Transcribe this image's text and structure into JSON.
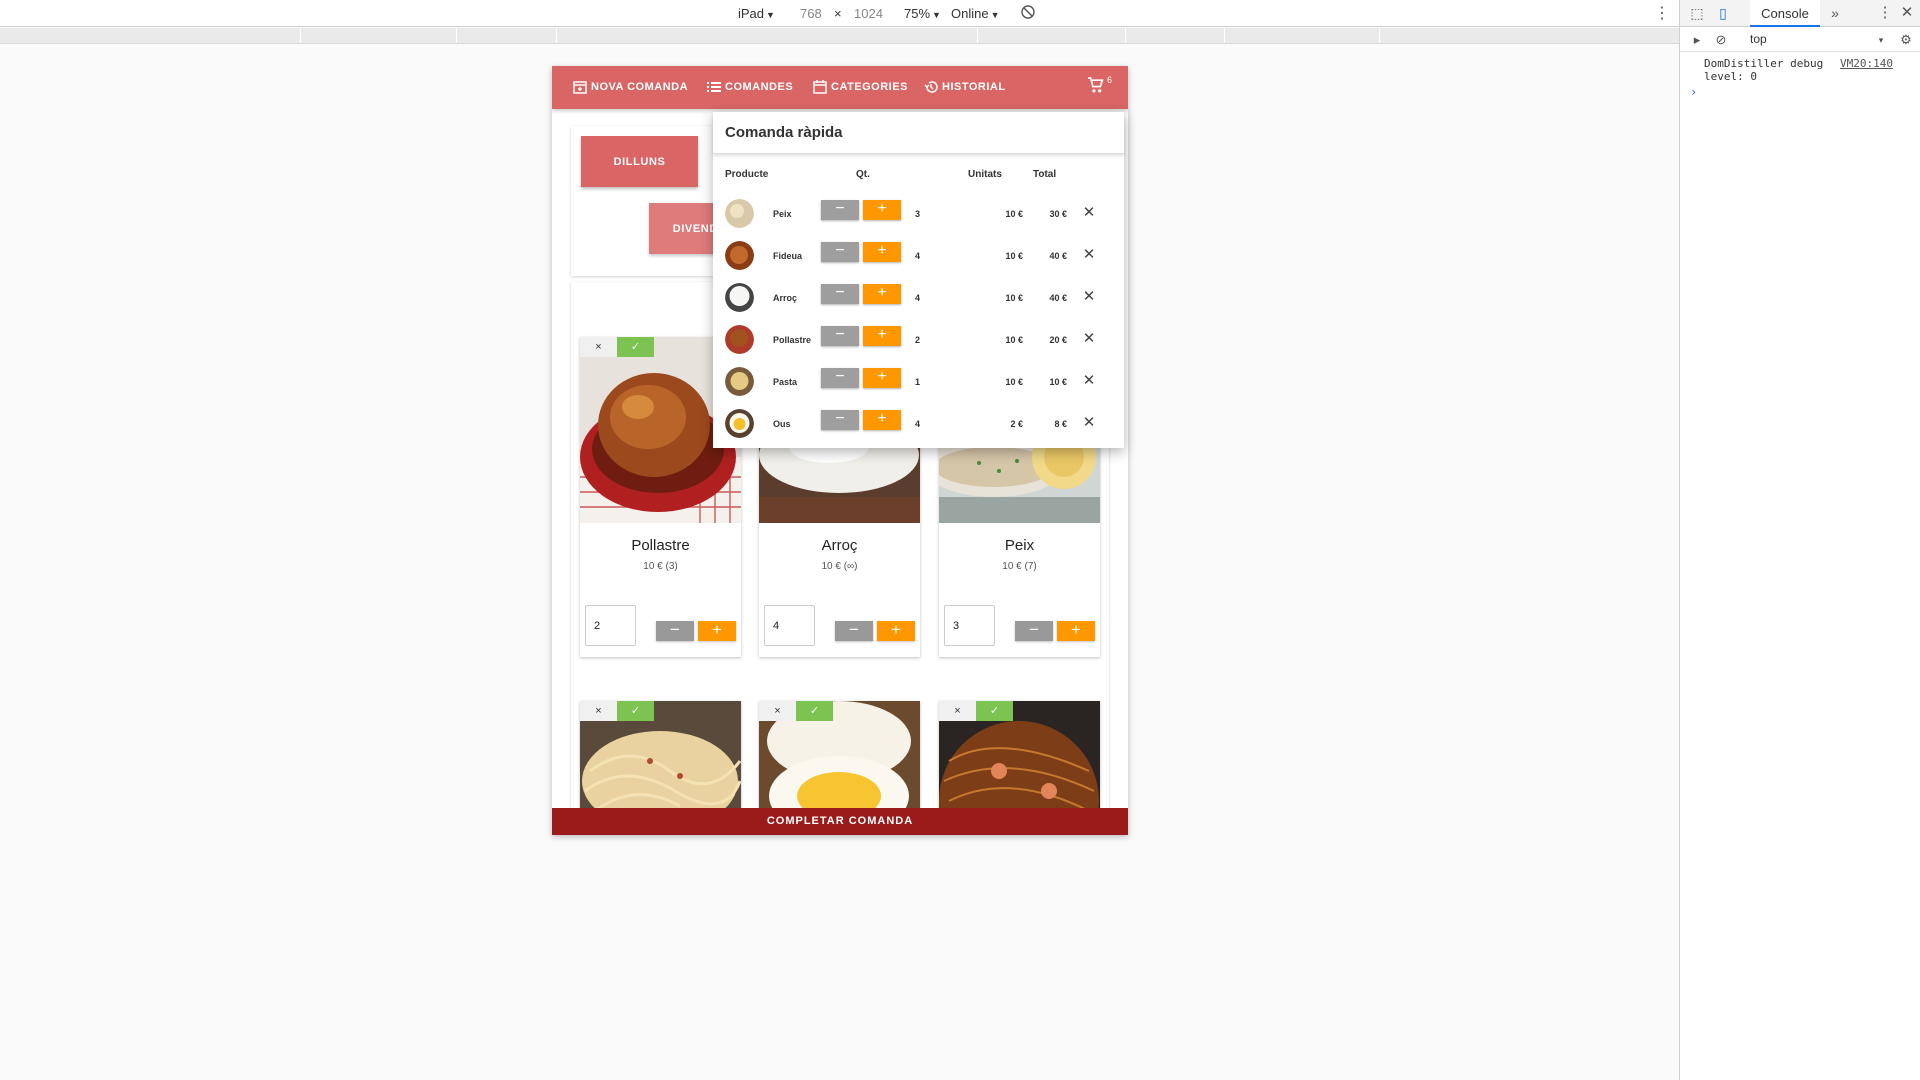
{
  "devtools_toolbar": {
    "device": "iPad",
    "width": "768",
    "times": "×",
    "height": "1024",
    "zoom": "75%",
    "network": "Online"
  },
  "devtools_panel": {
    "tab": "Console",
    "context": "top",
    "message": "DomDistiller debug level: 0",
    "source": "VM20:140",
    "prompt": "›"
  },
  "nav": {
    "items": [
      {
        "label": "NOVA COMANDA",
        "icon": "add-calendar-icon"
      },
      {
        "label": "COMANDES",
        "icon": "list-icon"
      },
      {
        "label": "CATEGORIES",
        "icon": "calendar-icon"
      },
      {
        "label": "HISTORIAL",
        "icon": "history-icon"
      }
    ],
    "cart_count": "6"
  },
  "days": [
    "DILLUNS",
    "DIVENDRES"
  ],
  "products": [
    {
      "name": "Pollastre",
      "price": "10 € (3)",
      "qty": "2"
    },
    {
      "name": "Arroç",
      "price": "10 € (∞)",
      "qty": "4"
    },
    {
      "name": "Peix",
      "price": "10 € (7)",
      "qty": "3"
    }
  ],
  "product_actions": {
    "delete": "×",
    "accept": "✓",
    "minus": "−",
    "plus": "+"
  },
  "quick_order": {
    "title": "Comanda ràpida",
    "headers": {
      "product": "Producte",
      "qty": "Qt.",
      "units": "Unitats",
      "total": "Total"
    },
    "rows": [
      {
        "name": "Peix",
        "qty": "3",
        "unit": "10 €",
        "total": "30 €"
      },
      {
        "name": "Fideua",
        "qty": "4",
        "unit": "10 €",
        "total": "40 €"
      },
      {
        "name": "Arroç",
        "qty": "4",
        "unit": "10 €",
        "total": "40 €"
      },
      {
        "name": "Pollastre",
        "qty": "2",
        "unit": "10 €",
        "total": "20 €"
      },
      {
        "name": "Pasta",
        "qty": "1",
        "unit": "10 €",
        "total": "10 €"
      },
      {
        "name": "Ous",
        "qty": "4",
        "unit": "2 €",
        "total": "8 €"
      }
    ]
  },
  "complete_label": "COMPLETAR COMANDA",
  "colors": {
    "primary": "#d96565",
    "accent": "#ff9800",
    "success": "#7cc352",
    "dark_red": "#9b1b1b"
  }
}
